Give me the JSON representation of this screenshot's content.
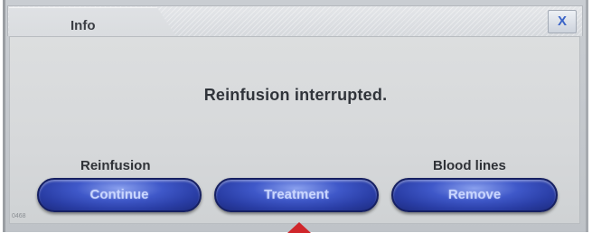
{
  "dialog": {
    "tab_title": "Info",
    "close_label": "X",
    "message": "Reinfusion interrupted.",
    "code": "0468"
  },
  "groups": {
    "left_label": "Reinfusion",
    "right_label": "Blood lines"
  },
  "buttons": {
    "continue_label": "Continue",
    "treatment_label": "Treatment",
    "remove_label": "Remove"
  },
  "colors": {
    "button_blue": "#2a3ea6",
    "pointer_red": "#d0262b"
  }
}
